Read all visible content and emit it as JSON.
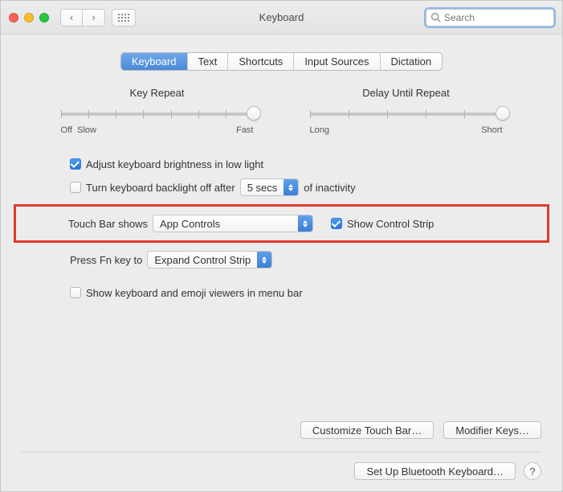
{
  "window": {
    "title": "Keyboard",
    "search_placeholder": "Search"
  },
  "tabs": [
    {
      "label": "Keyboard",
      "active": true
    },
    {
      "label": "Text",
      "active": false
    },
    {
      "label": "Shortcuts",
      "active": false
    },
    {
      "label": "Input Sources",
      "active": false
    },
    {
      "label": "Dictation",
      "active": false
    }
  ],
  "sliders": {
    "key_repeat": {
      "title": "Key Repeat",
      "left_label": "Off",
      "left_label2": "Slow",
      "right_label": "Fast",
      "num_ticks": 8,
      "value_index": 7
    },
    "delay_repeat": {
      "title": "Delay Until Repeat",
      "left_label": "Long",
      "right_label": "Short",
      "num_ticks": 6,
      "value_index": 5
    }
  },
  "options": {
    "adjust_brightness": {
      "label": "Adjust keyboard brightness in low light",
      "checked": true
    },
    "backlight_off": {
      "label": "Turn keyboard backlight off after",
      "checked": false,
      "select_value": "5 secs",
      "suffix": "of inactivity"
    },
    "touch_bar": {
      "label": "Touch Bar shows",
      "select_value": "App Controls"
    },
    "show_control_strip": {
      "label": "Show Control Strip",
      "checked": true
    },
    "press_fn": {
      "label": "Press Fn key to",
      "select_value": "Expand Control Strip"
    },
    "show_viewers": {
      "label": "Show keyboard and emoji viewers in menu bar",
      "checked": false
    }
  },
  "buttons": {
    "customize": "Customize Touch Bar…",
    "modifier": "Modifier Keys…",
    "bluetooth": "Set Up Bluetooth Keyboard…",
    "help": "?"
  }
}
